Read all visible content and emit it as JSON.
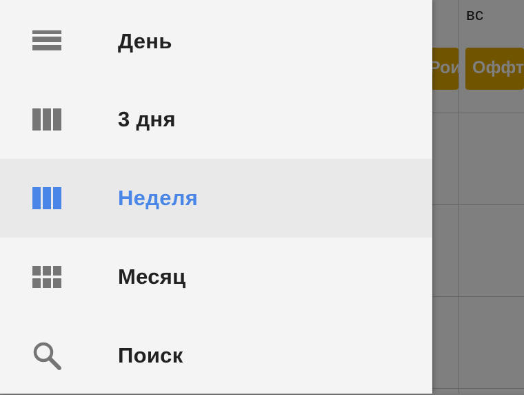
{
  "calendar": {
    "header_day": "вс",
    "events": [
      "Рои",
      "Оффт"
    ]
  },
  "drawer": {
    "selected_index": 2,
    "items": [
      {
        "label": "День",
        "icon": "day-view-icon"
      },
      {
        "label": "3 дня",
        "icon": "three-day-view-icon"
      },
      {
        "label": "Неделя",
        "icon": "week-view-icon"
      },
      {
        "label": "Месяц",
        "icon": "month-view-icon"
      },
      {
        "label": "Поиск",
        "icon": "search-icon"
      }
    ]
  },
  "colors": {
    "accent": "#4a86e8",
    "icon_gray": "#757575",
    "drawer_bg": "#f4f4f4",
    "selected_bg": "#e9e9e9",
    "event_bg": "#e0a800"
  }
}
